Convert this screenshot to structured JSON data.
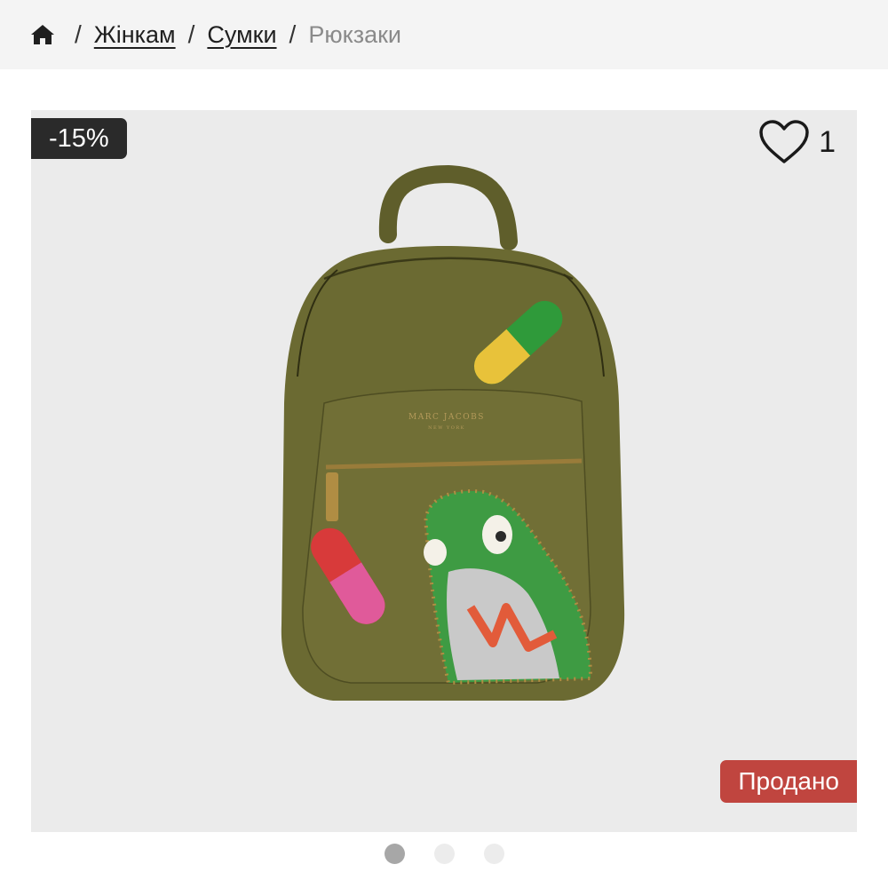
{
  "breadcrumb": {
    "home_icon": "home-icon",
    "items": [
      {
        "label": "Жінкам"
      },
      {
        "label": "Сумки"
      }
    ],
    "current": "Рюкзаки"
  },
  "product": {
    "discount_badge": "-15%",
    "favorite_icon": "heart-outline-icon",
    "favorite_count": "1",
    "status_badge": "Продано",
    "image_brand_text": "MARC JACOBS",
    "image_brand_sub": "NEW YORK"
  },
  "carousel": {
    "total_slides": 3,
    "active_slide": 1
  },
  "colors": {
    "sold_badge": "#c0453f",
    "discount_badge": "#2a2a2a",
    "backpack": "#6b6a32"
  }
}
